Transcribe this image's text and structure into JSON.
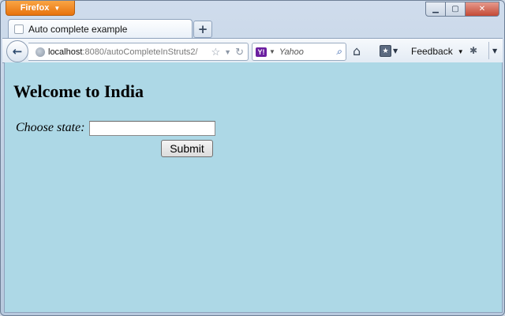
{
  "browser": {
    "app_button": "Firefox",
    "window_controls": {
      "minimize": "▁",
      "maximize": "▢",
      "close": "✕"
    },
    "tab": {
      "title": "Auto complete example"
    },
    "new_tab": "+",
    "url": {
      "host": "localhost",
      "path": ":8080/autoCompleteInStruts2/"
    },
    "search": {
      "placeholder": "Yahoo",
      "engine_icon": "Y!"
    },
    "toolbar": {
      "feedback_label": "Feedback"
    }
  },
  "page": {
    "heading": "Welcome to India",
    "state_label": "Choose state:",
    "state_value": "",
    "submit_label": "Submit"
  },
  "colors": {
    "content_background": "#add8e6",
    "firefox_button": "#e8730d"
  }
}
